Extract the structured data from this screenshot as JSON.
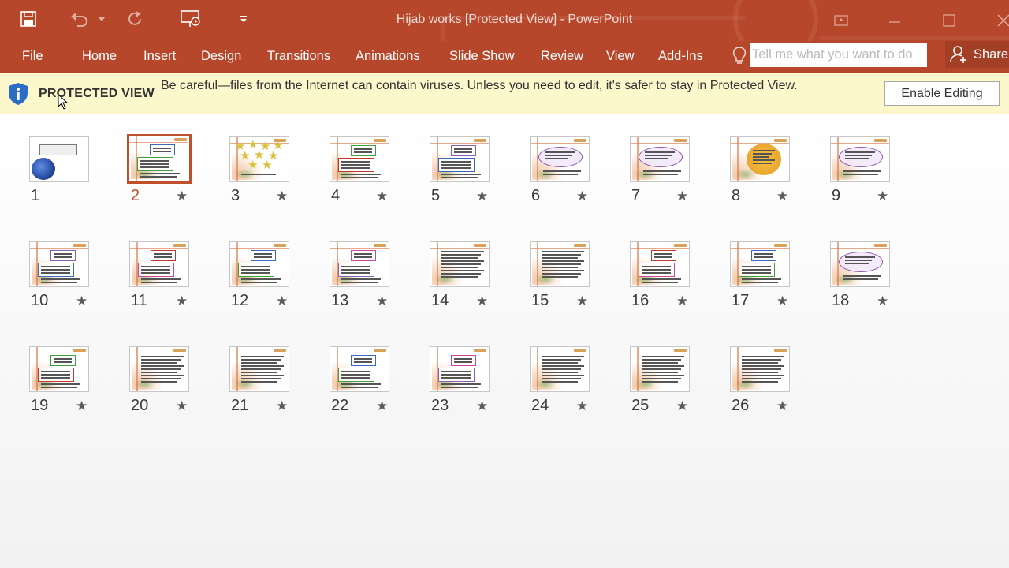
{
  "window": {
    "title": "Hijab works [Protected View] - PowerPoint"
  },
  "ribbon": {
    "tabs": [
      {
        "label": "File"
      },
      {
        "label": "Home"
      },
      {
        "label": "Insert"
      },
      {
        "label": "Design"
      },
      {
        "label": "Transitions"
      },
      {
        "label": "Animations"
      },
      {
        "label": "Slide Show"
      },
      {
        "label": "Review"
      },
      {
        "label": "View"
      },
      {
        "label": "Add-Ins"
      }
    ],
    "tell_me_placeholder": "Tell me what you want to do",
    "share_label": "Share"
  },
  "protected_view": {
    "title": "PROTECTED VIEW",
    "message": "Be careful—files from the Internet can contain viruses. Unless you need to edit, it's safer to stay in Protected View.",
    "button_label": "Enable Editing"
  },
  "slides": [
    {
      "number": "1",
      "has_animation": false,
      "selected": false,
      "style": "flower"
    },
    {
      "number": "2",
      "has_animation": true,
      "selected": true,
      "style": "boxes"
    },
    {
      "number": "3",
      "has_animation": true,
      "selected": false,
      "style": "stars"
    },
    {
      "number": "4",
      "has_animation": true,
      "selected": false,
      "style": "boxes"
    },
    {
      "number": "5",
      "has_animation": true,
      "selected": false,
      "style": "boxes"
    },
    {
      "number": "6",
      "has_animation": true,
      "selected": false,
      "style": "oval"
    },
    {
      "number": "7",
      "has_animation": true,
      "selected": false,
      "style": "oval"
    },
    {
      "number": "8",
      "has_animation": true,
      "selected": false,
      "style": "sun"
    },
    {
      "number": "9",
      "has_animation": true,
      "selected": false,
      "style": "oval"
    },
    {
      "number": "10",
      "has_animation": true,
      "selected": false,
      "style": "boxes"
    },
    {
      "number": "11",
      "has_animation": true,
      "selected": false,
      "style": "boxes"
    },
    {
      "number": "12",
      "has_animation": true,
      "selected": false,
      "style": "boxes"
    },
    {
      "number": "13",
      "has_animation": true,
      "selected": false,
      "style": "boxes"
    },
    {
      "number": "14",
      "has_animation": true,
      "selected": false,
      "style": "text"
    },
    {
      "number": "15",
      "has_animation": true,
      "selected": false,
      "style": "text"
    },
    {
      "number": "16",
      "has_animation": true,
      "selected": false,
      "style": "boxes"
    },
    {
      "number": "17",
      "has_animation": true,
      "selected": false,
      "style": "boxes"
    },
    {
      "number": "18",
      "has_animation": true,
      "selected": false,
      "style": "oval"
    },
    {
      "number": "19",
      "has_animation": true,
      "selected": false,
      "style": "boxes"
    },
    {
      "number": "20",
      "has_animation": true,
      "selected": false,
      "style": "text"
    },
    {
      "number": "21",
      "has_animation": true,
      "selected": false,
      "style": "text"
    },
    {
      "number": "22",
      "has_animation": true,
      "selected": false,
      "style": "boxes"
    },
    {
      "number": "23",
      "has_animation": true,
      "selected": false,
      "style": "boxes"
    },
    {
      "number": "24",
      "has_animation": true,
      "selected": false,
      "style": "text"
    },
    {
      "number": "25",
      "has_animation": true,
      "selected": false,
      "style": "text"
    },
    {
      "number": "26",
      "has_animation": true,
      "selected": false,
      "style": "text"
    }
  ],
  "colors": {
    "accent": "#b7472a",
    "protected_bar": "#fdf7cc",
    "selected_slide": "#c0502c"
  }
}
